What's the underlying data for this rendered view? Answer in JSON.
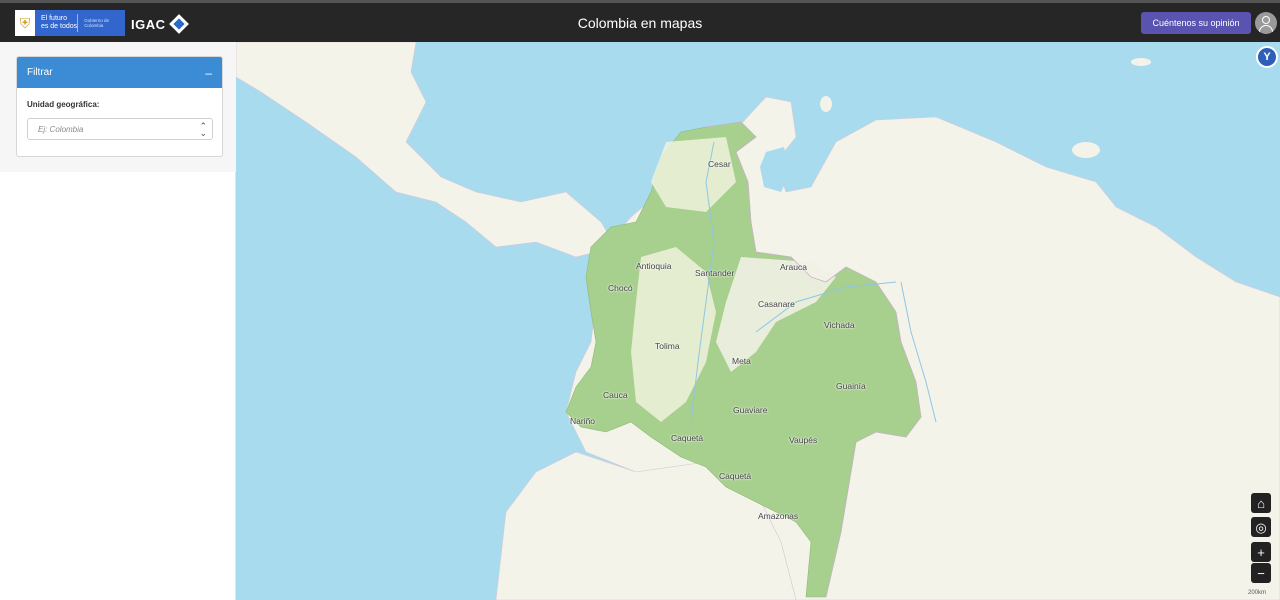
{
  "header": {
    "gov_logo_line1": "El futuro",
    "gov_logo_line2": "es de todos",
    "gov_logo_sub": "Gobierno de Colombia",
    "igac_logo": "IGAC",
    "title": "Colombia en mapas",
    "feedback_button": "Cuéntenos su opinión"
  },
  "sidebar": {
    "panel_title": "Filtrar",
    "collapse_symbol": "–",
    "field_label": "Unidad geográfica:",
    "select_placeholder": "Ej: Colombia"
  },
  "map": {
    "department_labels": [
      "Cesar",
      "Antioquia",
      "Santander",
      "Arauca",
      "Chocó",
      "Casanare",
      "Vichada",
      "Tolima",
      "Meta",
      "Guainía",
      "Cauca",
      "Guaviare",
      "Nariño",
      "Caquetá",
      "Vaupés",
      "Caquetá",
      "Amazonas"
    ],
    "scale": "200km",
    "colors": {
      "water": "#a8dbee",
      "land": "#f4f3ea",
      "forest": "#a7cf8e"
    }
  },
  "controls": {
    "compass_icon": "Y",
    "home_icon": "⌂",
    "locate_icon": "◎",
    "zoom_in": "+",
    "zoom_out": "−"
  }
}
